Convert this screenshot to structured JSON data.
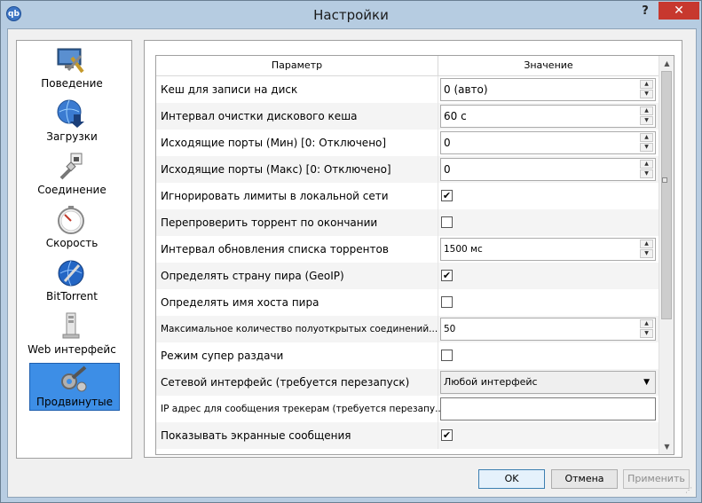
{
  "window": {
    "title": "Настройки",
    "app_icon": "qb",
    "help_label": "?",
    "close_label": "✕"
  },
  "sidebar": {
    "items": [
      {
        "label": "Поведение",
        "icon": "behavior-icon"
      },
      {
        "label": "Загрузки",
        "icon": "downloads-icon"
      },
      {
        "label": "Соединение",
        "icon": "connection-icon"
      },
      {
        "label": "Скорость",
        "icon": "speed-icon"
      },
      {
        "label": "BitTorrent",
        "icon": "bittorrent-icon"
      },
      {
        "label": "Web интерфейс",
        "icon": "web-ui-icon"
      },
      {
        "label": "Продвинутые",
        "icon": "advanced-icon",
        "selected": true
      }
    ]
  },
  "table": {
    "headers": {
      "param": "Параметр",
      "value": "Значение"
    },
    "rows": [
      {
        "label": "Кеш для записи на диск",
        "type": "spin",
        "value": "0 (авто)"
      },
      {
        "label": "Интервал очистки дискового кеша",
        "type": "spin",
        "value": "60 с"
      },
      {
        "label": "Исходящие порты (Мин) [0: Отключено]",
        "type": "spin",
        "value": "0"
      },
      {
        "label": "Исходящие порты (Макс) [0: Отключено]",
        "type": "spin",
        "value": "0"
      },
      {
        "label": "Игнорировать лимиты в локальной сети",
        "type": "check",
        "checked": true
      },
      {
        "label": "Перепроверить торрент по окончании",
        "type": "check",
        "checked": false
      },
      {
        "label": "Интервал обновления списка торрентов",
        "type": "spin",
        "value": "1500 мс"
      },
      {
        "label": "Определять страну пира (GeoIP)",
        "type": "check",
        "checked": true
      },
      {
        "label": "Определять имя хоста пира",
        "type": "check",
        "checked": false
      },
      {
        "label": "Максимальное количество полуоткрытых соединений...",
        "type": "spin",
        "value": "50"
      },
      {
        "label": "Режим супер раздачи",
        "type": "check",
        "checked": false
      },
      {
        "label": "Сетевой интерфейс (требуется перезапуск)",
        "type": "combo",
        "value": "Любой интерфейс"
      },
      {
        "label": "IP адрес для сообщения трекерам (требуется перезапу...",
        "type": "text",
        "value": ""
      },
      {
        "label": "Показывать экранные сообщения",
        "type": "check",
        "checked": true
      }
    ]
  },
  "buttons": {
    "ok": "OK",
    "cancel": "Отмена",
    "apply": "Применить"
  },
  "colors": {
    "titlebar": "#b6cce1",
    "close": "#c7382e",
    "selected": "#3d8ee6"
  }
}
